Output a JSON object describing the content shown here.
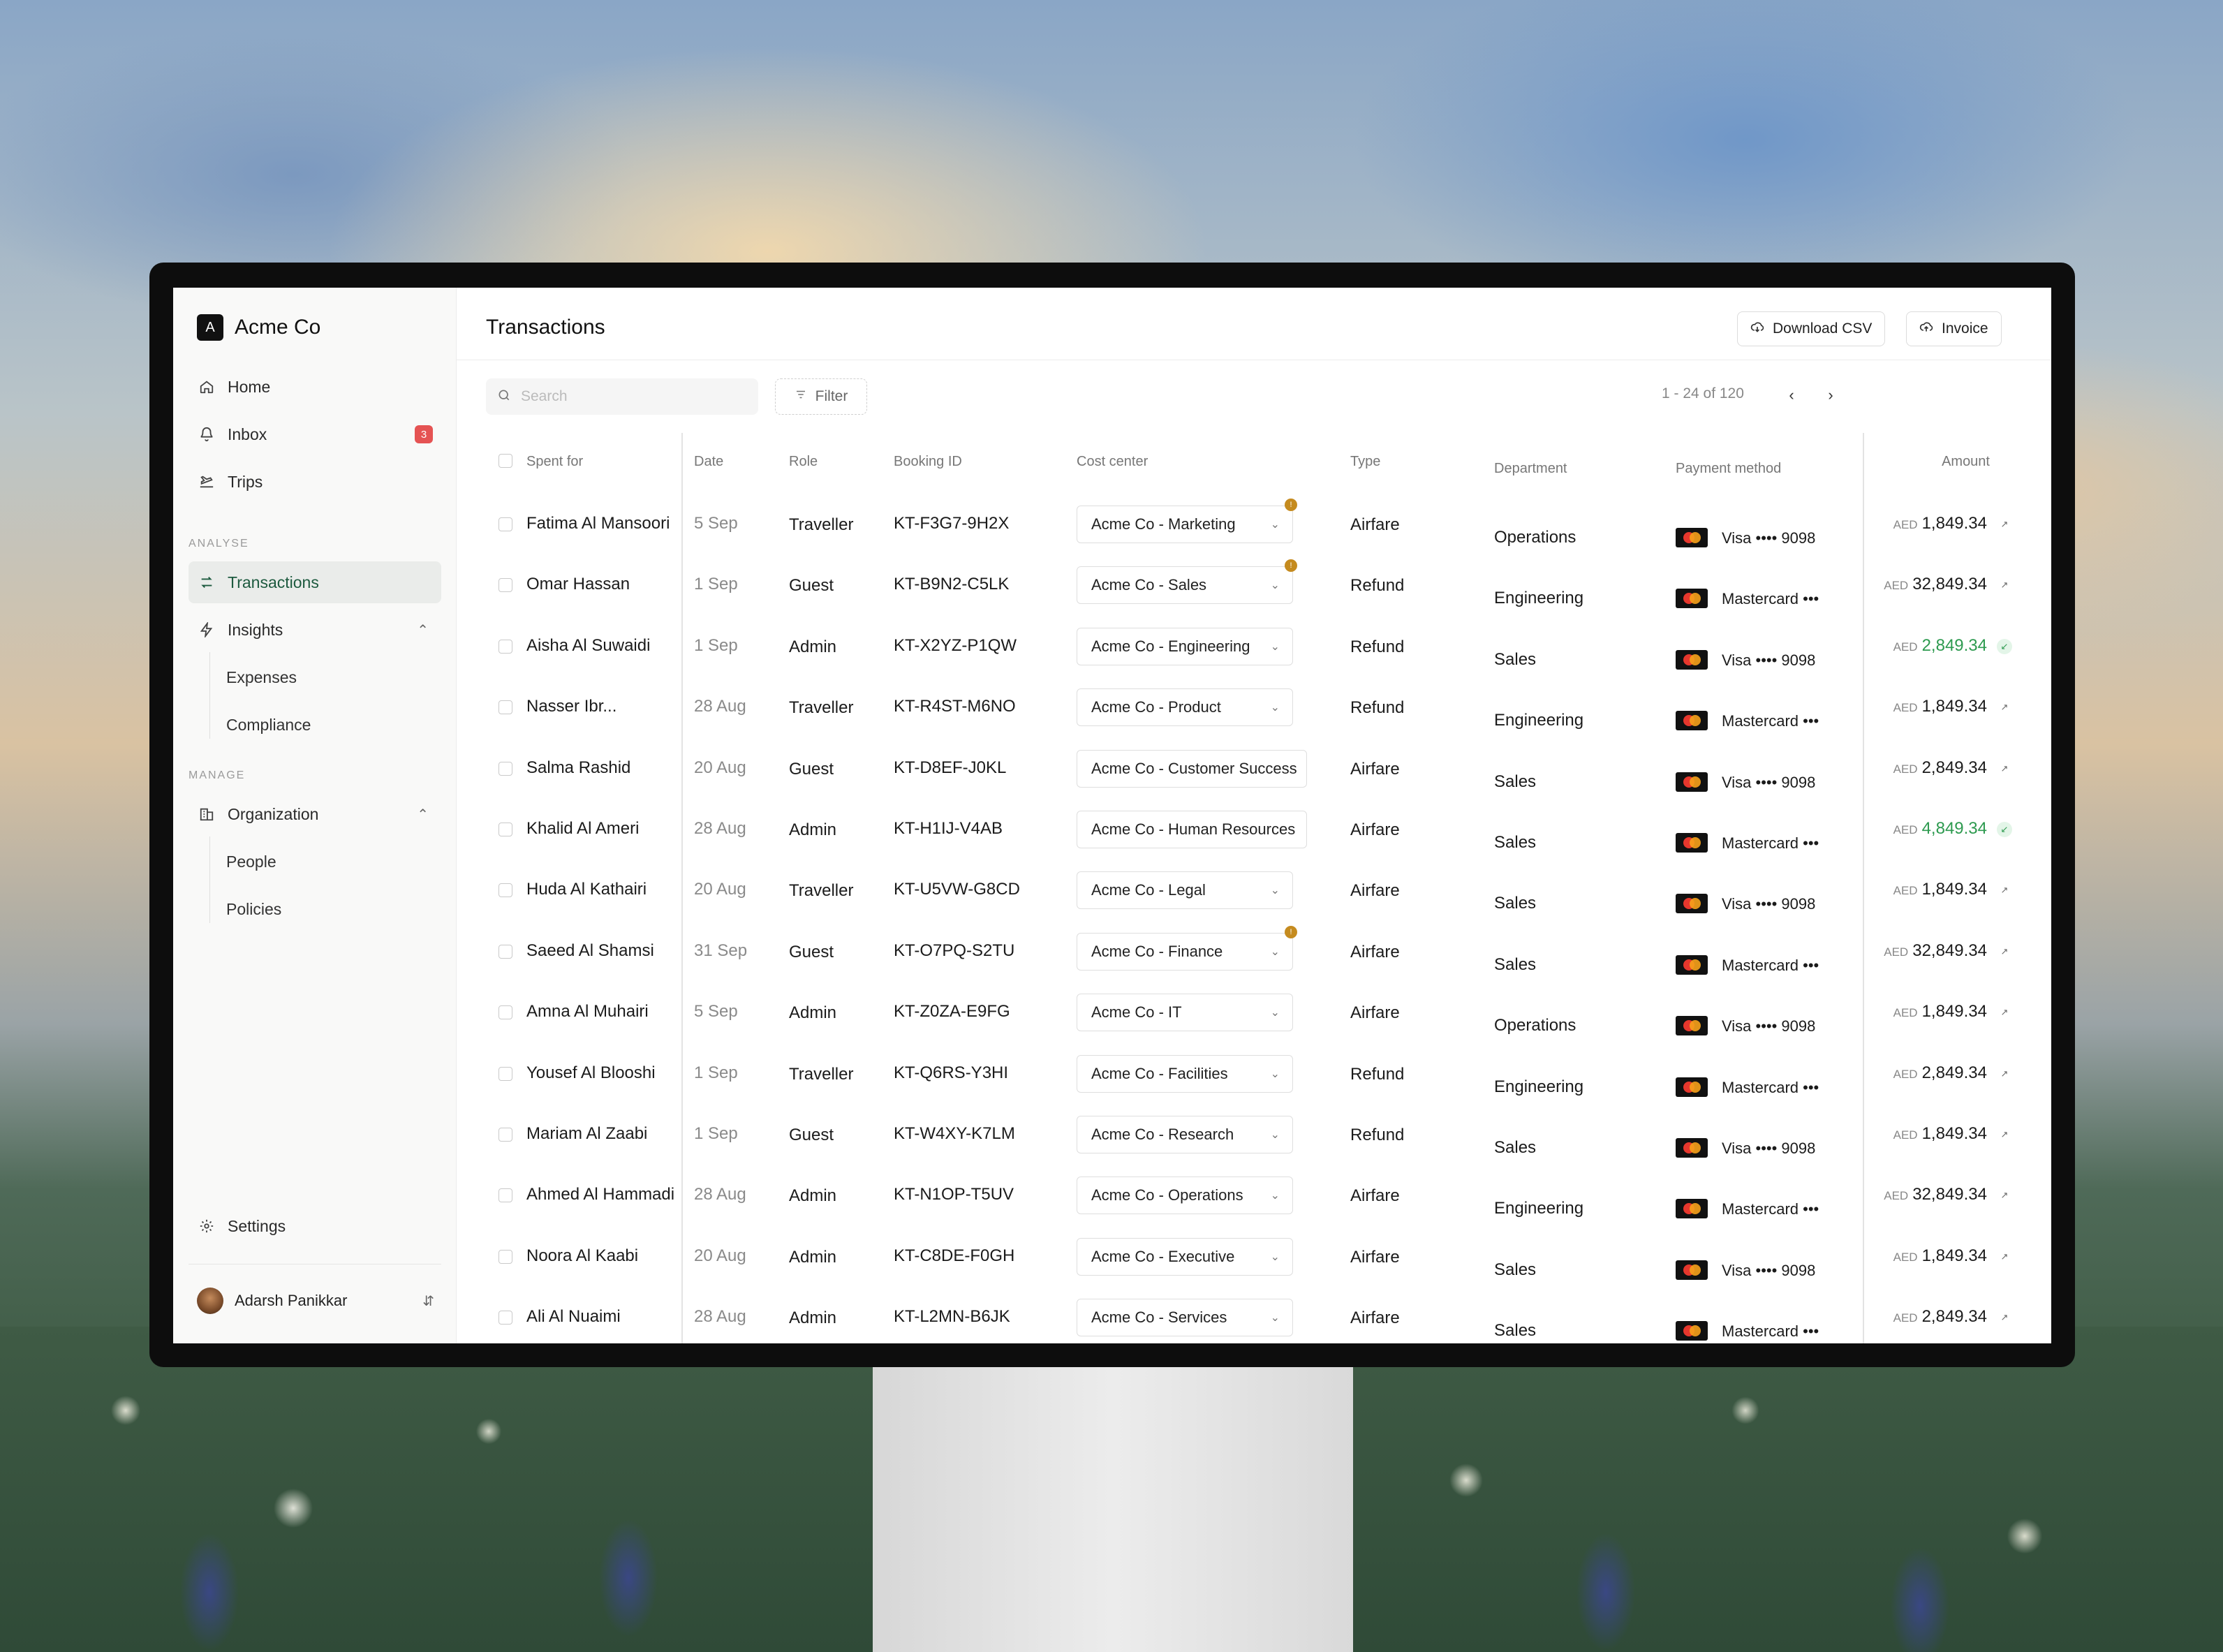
{
  "app": {
    "brand_initial": "A",
    "brand_name": "Acme Co"
  },
  "sidebar": {
    "home": "Home",
    "inbox": "Inbox",
    "inbox_count": "3",
    "trips": "Trips",
    "section_analyse": "ANALYSE",
    "transactions": "Transactions",
    "insights": "Insights",
    "expenses": "Expenses",
    "compliance": "Compliance",
    "section_manage": "MANAGE",
    "organization": "Organization",
    "people": "People",
    "policies": "Policies",
    "settings": "Settings",
    "user_name": "Adarsh Panikkar"
  },
  "header": {
    "title": "Transactions",
    "download_csv": "Download CSV",
    "invoice": "Invoice"
  },
  "toolbar": {
    "search_placeholder": "Search",
    "filter": "Filter",
    "range": "1 - 24 of 120"
  },
  "columns": {
    "spent_for": "Spent for",
    "date": "Date",
    "role": "Role",
    "booking_id": "Booking ID",
    "cost_center": "Cost center",
    "type": "Type",
    "department": "Department",
    "payment_method": "Payment method",
    "amount": "Amount"
  },
  "colors": {
    "accent": "#1d5a3f",
    "positive": "#2d9a4f",
    "warning": "#c58b1f",
    "badge": "#e55353"
  },
  "rows": [
    {
      "name": "Fatima Al Mansoori",
      "date": "5 Sep",
      "role": "Traveller",
      "booking": "KT-F3G7-9H2X",
      "cost_center": "Acme Co - Marketing",
      "type": "Airfare",
      "department": "Operations",
      "payment": "Visa •••• 9098",
      "currency": "AED",
      "amount": "1,849.34"
    },
    {
      "name": "Omar Hassan",
      "date": "1 Sep",
      "role": "Guest",
      "booking": "KT-B9N2-C5LK",
      "cost_center": "Acme Co - Sales",
      "type": "Refund",
      "department": "Engineering",
      "payment": "Mastercard •••",
      "currency": "AED",
      "amount": "32,849.34"
    },
    {
      "name": "Aisha Al Suwaidi",
      "date": "1 Sep",
      "role": "Admin",
      "booking": "KT-X2YZ-P1QW",
      "cost_center": "Acme Co - Engineering",
      "type": "Refund",
      "department": "Sales",
      "payment": "Visa •••• 9098",
      "currency": "AED",
      "amount": "2,849.34"
    },
    {
      "name": "Nasser Ibr...",
      "date": "28 Aug",
      "role": "Traveller",
      "booking": "KT-R4ST-M6NO",
      "cost_center": "Acme Co - Product",
      "type": "Refund",
      "department": "Engineering",
      "payment": "Mastercard •••",
      "currency": "AED",
      "amount": "1,849.34"
    },
    {
      "name": "Salma Rashid",
      "date": "20 Aug",
      "role": "Guest",
      "booking": "KT-D8EF-J0KL",
      "cost_center": "Acme Co - Customer Success",
      "type": "Airfare",
      "department": "Sales",
      "payment": "Visa •••• 9098",
      "currency": "AED",
      "amount": "2,849.34"
    },
    {
      "name": "Khalid Al Ameri",
      "date": "28 Aug",
      "role": "Admin",
      "booking": "KT-H1IJ-V4AB",
      "cost_center": "Acme Co - Human Resources",
      "type": "Airfare",
      "department": "Sales",
      "payment": "Mastercard •••",
      "currency": "AED",
      "amount": "4,849.34"
    },
    {
      "name": "Huda Al Kathairi",
      "date": "20 Aug",
      "role": "Traveller",
      "booking": "KT-U5VW-G8CD",
      "cost_center": "Acme Co - Legal",
      "type": "Airfare",
      "department": "Sales",
      "payment": "Visa •••• 9098",
      "currency": "AED",
      "amount": "1,849.34"
    },
    {
      "name": "Saeed Al Shamsi",
      "date": "31 Sep",
      "role": "Guest",
      "booking": "KT-O7PQ-S2TU",
      "cost_center": "Acme Co - Finance",
      "type": "Airfare",
      "department": "Sales",
      "payment": "Mastercard •••",
      "currency": "AED",
      "amount": "32,849.34"
    },
    {
      "name": "Amna Al Muhairi",
      "date": "5 Sep",
      "role": "Admin",
      "booking": "KT-Z0ZA-E9FG",
      "cost_center": "Acme Co - IT",
      "type": "Airfare",
      "department": "Operations",
      "payment": "Visa •••• 9098",
      "currency": "AED",
      "amount": "1,849.34"
    },
    {
      "name": "Yousef Al Blooshi",
      "date": "1 Sep",
      "role": "Traveller",
      "booking": "KT-Q6RS-Y3HI",
      "cost_center": "Acme Co - Facilities",
      "type": "Refund",
      "department": "Engineering",
      "payment": "Mastercard •••",
      "currency": "AED",
      "amount": "2,849.34"
    },
    {
      "name": "Mariam Al Zaabi",
      "date": "1 Sep",
      "role": "Guest",
      "booking": "KT-W4XY-K7LM",
      "cost_center": "Acme Co - Research",
      "type": "Refund",
      "department": "Sales",
      "payment": "Visa •••• 9098",
      "currency": "AED",
      "amount": "1,849.34"
    },
    {
      "name": "Ahmed Al Hammadi",
      "date": "28 Aug",
      "role": "Admin",
      "booking": "KT-N1OP-T5UV",
      "cost_center": "Acme Co - Operations",
      "type": "Airfare",
      "department": "Engineering",
      "payment": "Mastercard •••",
      "currency": "AED",
      "amount": "32,849.34"
    },
    {
      "name": "Noora Al Kaabi",
      "date": "20 Aug",
      "role": "Admin",
      "booking": "KT-C8DE-F0GH",
      "cost_center": "Acme Co - Executive",
      "type": "Airfare",
      "department": "Sales",
      "payment": "Visa •••• 9098",
      "currency": "AED",
      "amount": "1,849.34"
    },
    {
      "name": "Ali Al Nuaimi",
      "date": "28 Aug",
      "role": "Admin",
      "booking": "KT-L2MN-B6JK",
      "cost_center": "Acme Co - Services",
      "type": "Airfare",
      "department": "Sales",
      "payment": "Mastercard •••",
      "currency": "AED",
      "amount": "2,849.34"
    }
  ]
}
